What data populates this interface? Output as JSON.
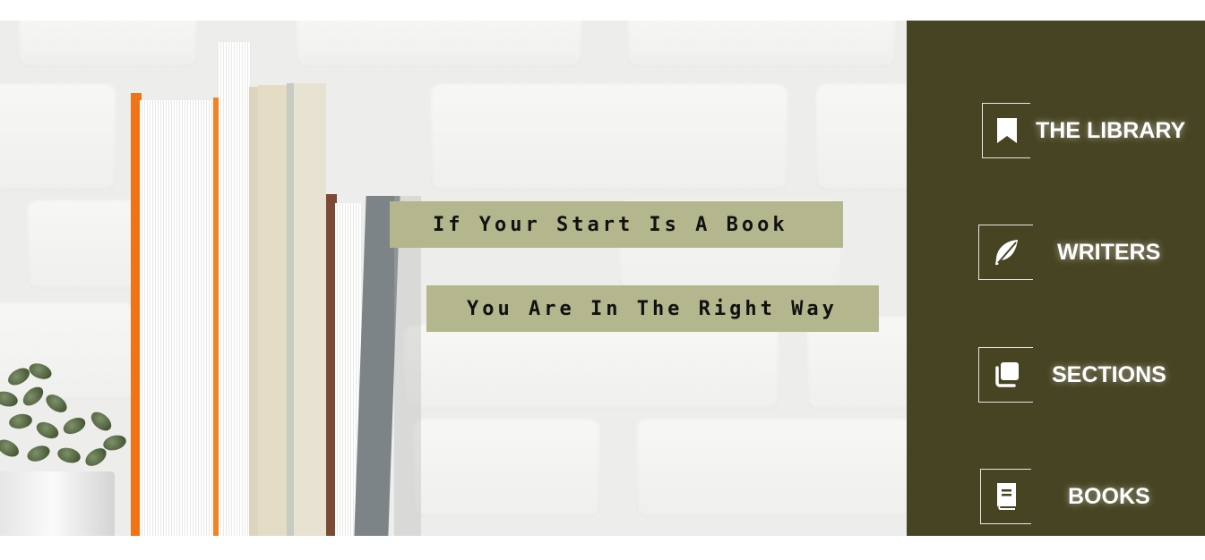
{
  "hero": {
    "line_1": "If Your Start Is A Book",
    "line_2": "You Are In The Right Way"
  },
  "nav": {
    "items": [
      {
        "label": "THE LIBRARY",
        "icon": "bookmark-icon"
      },
      {
        "label": "WRITERS",
        "icon": "feather-icon"
      },
      {
        "label": "SECTIONS",
        "icon": "copy-icon"
      },
      {
        "label": "BOOKS",
        "icon": "book-icon"
      }
    ]
  },
  "colors": {
    "sidebar_bg": "#464422",
    "banner_bg": "#b4b78d",
    "nav_text": "#ffffff"
  }
}
